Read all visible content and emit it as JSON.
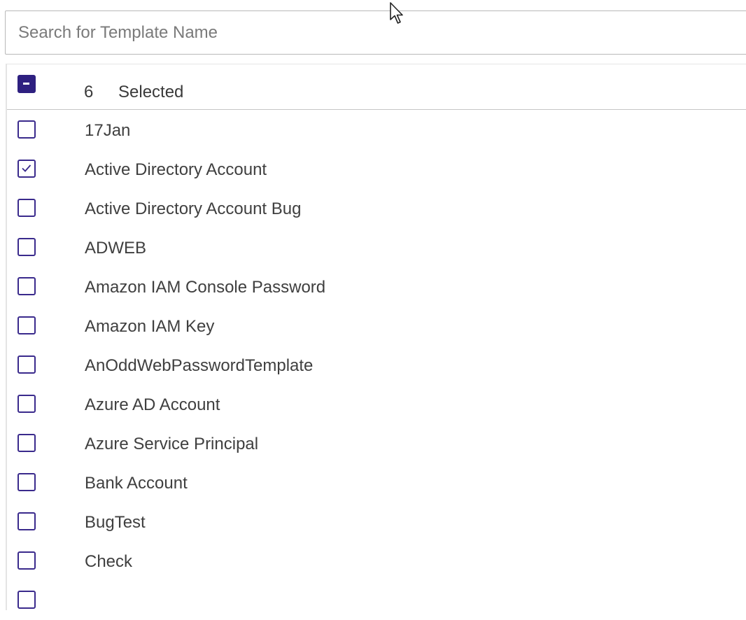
{
  "search": {
    "placeholder": "Search for Template Name",
    "value": ""
  },
  "header": {
    "count": "6",
    "selected_label": "Selected",
    "state": "indeterminate"
  },
  "colors": {
    "accent": "#2e2080",
    "border": "#3a2a8c",
    "text": "#3f3f3f"
  },
  "items": [
    {
      "label": "17Jan",
      "checked": false
    },
    {
      "label": "Active Directory Account",
      "checked": true
    },
    {
      "label": "Active Directory Account Bug",
      "checked": false
    },
    {
      "label": "ADWEB",
      "checked": false
    },
    {
      "label": "Amazon IAM Console Password",
      "checked": false
    },
    {
      "label": "Amazon IAM Key",
      "checked": false
    },
    {
      "label": "AnOddWebPasswordTemplate",
      "checked": false
    },
    {
      "label": "Azure AD Account",
      "checked": false
    },
    {
      "label": "Azure Service Principal",
      "checked": false
    },
    {
      "label": "Bank Account",
      "checked": false
    },
    {
      "label": "BugTest",
      "checked": false
    },
    {
      "label": "Check",
      "checked": false
    }
  ]
}
